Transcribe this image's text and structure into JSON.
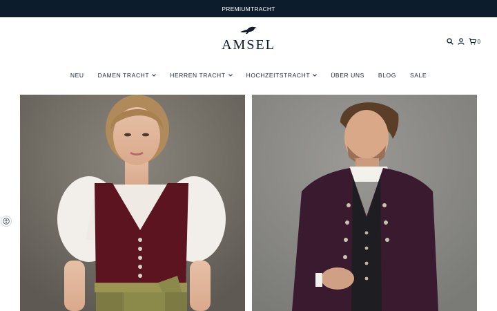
{
  "announcement": {
    "text": "PREMIUMTRACHT"
  },
  "brand": {
    "name": "AMSEL",
    "logo_icon": "bird-icon"
  },
  "header": {
    "search_icon": "search-icon",
    "account_icon": "user-icon",
    "cart_icon": "cart-icon",
    "cart_count": "0"
  },
  "nav": {
    "items": [
      {
        "label": "NEU",
        "dropdown": false
      },
      {
        "label": "DAMEN TRACHT",
        "dropdown": true
      },
      {
        "label": "HERREN TRACHT",
        "dropdown": true
      },
      {
        "label": "HOCHZEITSTRACHT",
        "dropdown": true
      },
      {
        "label": "ÜBER UNS",
        "dropdown": false
      },
      {
        "label": "BLOG",
        "dropdown": false
      },
      {
        "label": "SALE",
        "dropdown": false
      }
    ]
  },
  "colors": {
    "announcement_bg": "#0c1c2c",
    "text": "#0f1b2d",
    "dirndl_bodice": "#5c1420",
    "jacket_velvet": "#3a1a2e",
    "apron": "#8b8a4a"
  },
  "accessibility": {
    "icon": "accessibility-icon"
  }
}
